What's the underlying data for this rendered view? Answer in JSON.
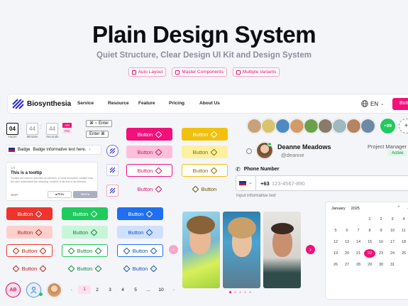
{
  "hero": {
    "title": "Plain Design System",
    "subtitle": "Quiet Structure, Clear Design UI Kit and Design System",
    "chips": [
      "Auto Layout",
      "Master Components",
      "Multiple Variants"
    ]
  },
  "nav": {
    "brand": "Biosynthesia",
    "links": [
      "Service",
      "Resource",
      "Feature",
      "Pricing",
      "About Us"
    ],
    "lang": "EN",
    "cta": "Button"
  },
  "time": {
    "hours": "04",
    "minutes": "44",
    "seconds": "44",
    "labels": [
      "Hours",
      "Minutes",
      "Seconds"
    ],
    "am": "AM",
    "pm": "PM",
    "kbd1": "⌘ ○ Enter",
    "kbd2": "Enter ⌘"
  },
  "badge": {
    "label": "Badge",
    "text": "Badge informative text here."
  },
  "tooltip": {
    "step": "1/3",
    "title": "This is a tooltip",
    "body": "Tooltips are used to describe an element. In most scenarios, tooltips help the user understand the meaning, function or alt-text of an element.",
    "skip": "SKIP",
    "prev": "Prev",
    "next": "Next"
  },
  "buttons": {
    "label": "Button"
  },
  "colors": {
    "pink": "#f2107a",
    "yellow": "#f2c10f",
    "red": "#f0342c",
    "green": "#1fcb5d",
    "blue": "#1f6ff0"
  },
  "avatars": {
    "initials": "AB",
    "group_count": "+99"
  },
  "pager": {
    "pages": [
      "1",
      "2",
      "3",
      "4",
      "5",
      "...",
      "10"
    ]
  },
  "profile": {
    "name": "Deanne Meadows",
    "handle": "@deanne",
    "role": "Project Manager",
    "status": "Active"
  },
  "phone": {
    "label": "Phone Number",
    "code": "+63",
    "placeholder": "123-4567-890",
    "hint": "Input informative text"
  },
  "calendar": {
    "month": "January",
    "year": "2025",
    "days": [
      "",
      "",
      "",
      "1",
      "2",
      "3",
      "4",
      "5",
      "6",
      "7",
      "8",
      "9",
      "10",
      "11",
      "12",
      "13",
      "14",
      "15",
      "16",
      "17",
      "18",
      "19",
      "20",
      "21",
      "22",
      "23",
      "24",
      "25",
      "26",
      "27",
      "28",
      "29",
      "30",
      "31",
      ""
    ],
    "selected": "22"
  }
}
